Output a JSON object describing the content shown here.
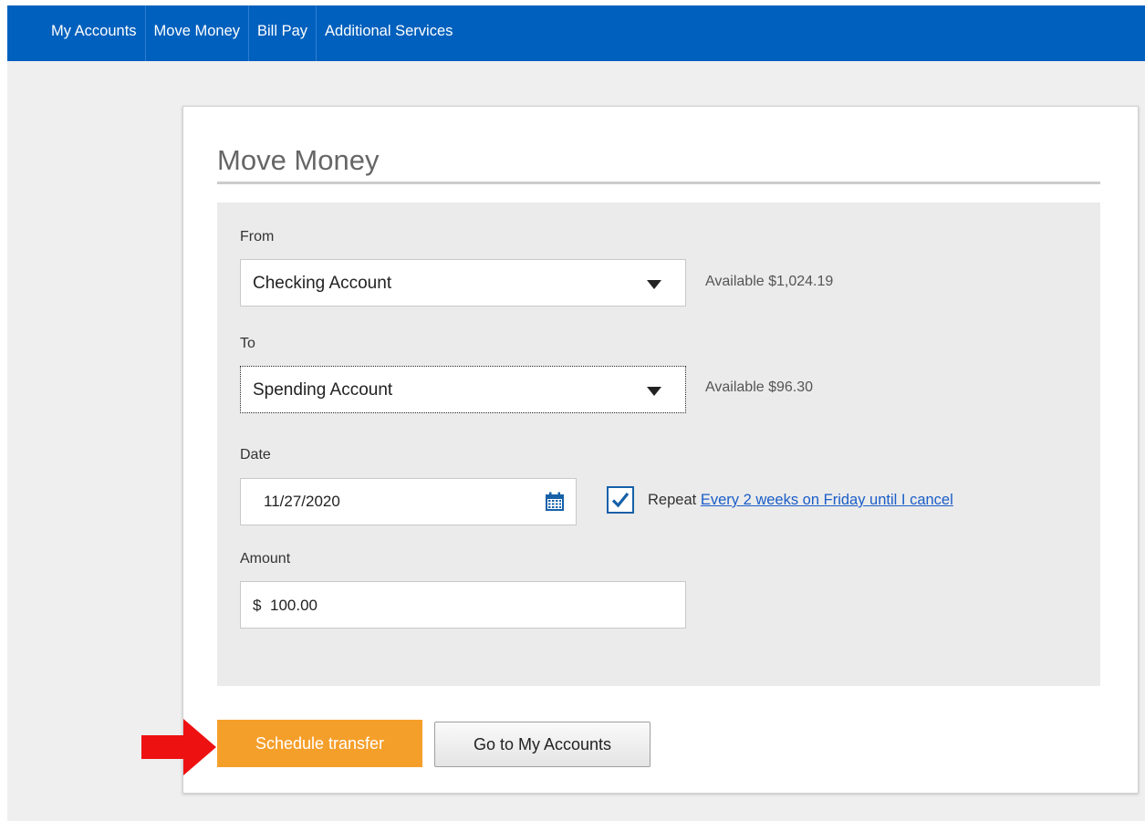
{
  "nav": {
    "items": [
      {
        "label": "My Accounts"
      },
      {
        "label": "Move Money"
      },
      {
        "label": "Bill Pay"
      },
      {
        "label": "Additional Services"
      }
    ],
    "background_color": "#0060bd"
  },
  "page": {
    "title": "Move Money"
  },
  "form": {
    "from": {
      "label": "From",
      "selected": "Checking Account",
      "available": "Available $1,024.19"
    },
    "to": {
      "label": "To",
      "selected": "Spending Account",
      "available": "Available $96.30"
    },
    "date": {
      "label": "Date",
      "value": "11/27/2020",
      "icon": "calendar-icon"
    },
    "repeat": {
      "checked": true,
      "label": "Repeat",
      "link_text": "Every 2 weeks on Friday until I cancel"
    },
    "amount": {
      "label": "Amount",
      "currency_symbol": "$",
      "value": "100.00"
    }
  },
  "actions": {
    "primary_label": "Schedule transfer",
    "secondary_label": "Go to My Accounts",
    "primary_color": "#f59f2b"
  },
  "annotation": {
    "icon": "red-arrow-icon",
    "color": "#ee1111"
  }
}
